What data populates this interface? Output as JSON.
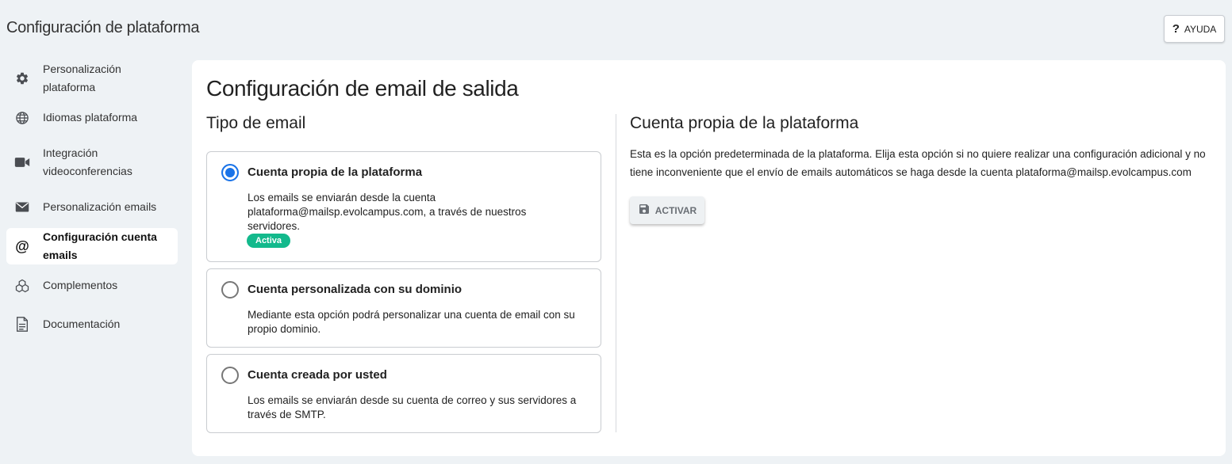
{
  "header": {
    "title": "Configuración de plataforma",
    "help_label": "AYUDA"
  },
  "sidebar": {
    "items": [
      {
        "label": "Personalización plataforma",
        "icon": "gear-icon"
      },
      {
        "label": "Idiomas plataforma",
        "icon": "globe-icon"
      },
      {
        "label": "Integración videoconferencias",
        "icon": "video-camera-icon"
      },
      {
        "label": "Personalización emails",
        "icon": "envelope-icon"
      },
      {
        "label": "Configuración cuenta emails",
        "icon": "at-sign-icon",
        "active": true
      },
      {
        "label": "Complementos",
        "icon": "cubes-icon"
      },
      {
        "label": "Documentación",
        "icon": "document-icon"
      }
    ]
  },
  "main": {
    "title": "Configuración de email de salida",
    "email_type_title": "Tipo de email",
    "options": [
      {
        "title": "Cuenta propia de la plataforma",
        "description": "Los emails se enviarán desde la cuenta plataforma@mailsp.evolcampus.com, a través de nuestros servidores.",
        "selected": true,
        "badge": "Activa"
      },
      {
        "title": "Cuenta personalizada con su dominio",
        "description": "Mediante esta opción podrá personalizar una cuenta de email con su propio dominio.",
        "selected": false
      },
      {
        "title": "Cuenta creada por usted",
        "description": "Los emails se enviarán desde su cuenta de correo y sus servidores a través de SMTP.",
        "selected": false
      }
    ],
    "detail": {
      "title": "Cuenta propia de la plataforma",
      "description": "Esta es la opción predeterminada de la plataforma. Elija esta opción si no quiere realizar una configuración adicional y no tiene inconveniente que el envío de emails automáticos se haga desde la cuenta plataforma@mailsp.evolcampus.com",
      "activate_label": "ACTIVAR"
    }
  },
  "colors": {
    "background": "#eef2f5",
    "accent": "#1a73e8",
    "badge": "#13b98c"
  }
}
